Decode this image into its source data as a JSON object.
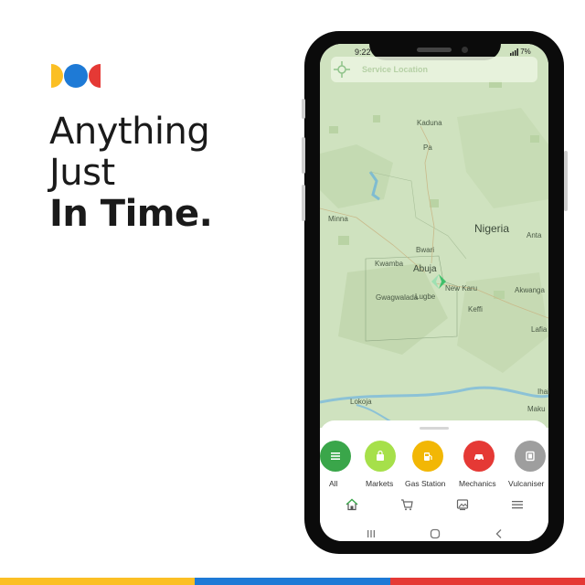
{
  "headline": {
    "line1": "Anything",
    "line2": "Just",
    "line3": "In Time."
  },
  "status_bar": {
    "time": "9:22",
    "battery": "7%"
  },
  "search": {
    "label": "Service Location"
  },
  "map": {
    "places": [
      "Kaduna",
      "Pa",
      "Minna",
      "Nigeria",
      "Anta",
      "Bwari",
      "Kwamba",
      "Abuja",
      "New Karu",
      "Gwagwalada",
      "Lugbe",
      "Keffi",
      "Akwanga",
      "Lafia",
      "Ihai",
      "Lokoja",
      "Maku"
    ]
  },
  "categories": [
    {
      "label": "All",
      "color": "#3aa64a",
      "icon": "list-icon"
    },
    {
      "label": "Markets",
      "color": "#a6e04a",
      "icon": "shopping-bag-icon"
    },
    {
      "label": "Gas Station",
      "color": "#f2b705",
      "icon": "fuel-pump-icon"
    },
    {
      "label": "Mechanics",
      "color": "#e53935",
      "icon": "car-icon"
    },
    {
      "label": "Vulcaniser",
      "color": "#9e9e9e",
      "icon": "tire-icon"
    }
  ],
  "bottom_nav": [
    "home-icon",
    "cart-icon",
    "image-icon",
    "menu-icon"
  ],
  "brand_colors": {
    "yellow": "#fbbf24",
    "blue": "#1e7ad6",
    "red": "#e53935"
  }
}
